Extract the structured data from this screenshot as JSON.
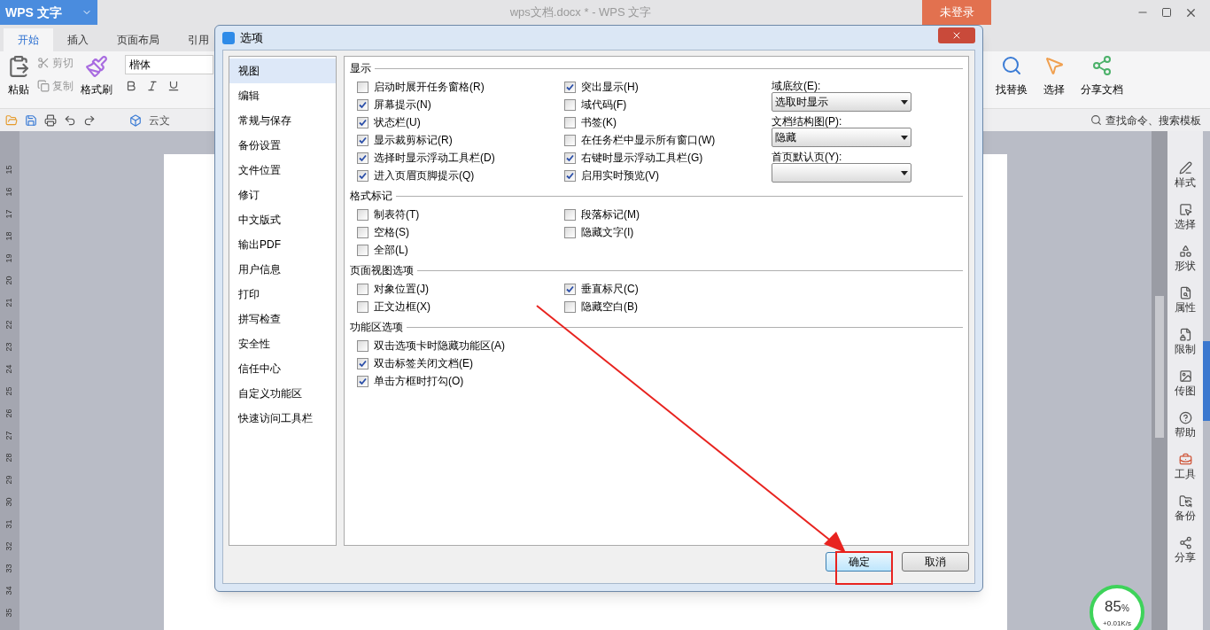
{
  "app": {
    "logo": "WPS 文字",
    "title": "wps文档.docx * - WPS 文字",
    "login": "未登录"
  },
  "tabs": [
    {
      "label": "开始",
      "selected": true
    },
    {
      "label": "插入",
      "selected": false
    },
    {
      "label": "页面布局",
      "selected": false
    },
    {
      "label": "引用",
      "selected": false
    }
  ],
  "ribbon": {
    "paste": "粘贴",
    "cut": "剪切",
    "copy": "复制",
    "format_painter": "格式刷",
    "font": "楷体",
    "find_replace": "找替换",
    "select": "选择",
    "share": "分享文档"
  },
  "quick_toolbar": {
    "cloud": "云文",
    "search": "查找命令、搜索模板"
  },
  "ruler": [
    "15",
    "16",
    "17",
    "18",
    "19",
    "20",
    "21",
    "22",
    "23",
    "24",
    "25",
    "26",
    "27",
    "28",
    "29",
    "30",
    "31",
    "32",
    "33",
    "34",
    "35"
  ],
  "dialog": {
    "title": "选项",
    "nav": [
      {
        "label": "视图",
        "selected": true
      },
      {
        "label": "编辑",
        "selected": false
      },
      {
        "label": "常规与保存",
        "selected": false
      },
      {
        "label": "备份设置",
        "selected": false
      },
      {
        "label": "文件位置",
        "selected": false
      },
      {
        "label": "修订",
        "selected": false
      },
      {
        "label": "中文版式",
        "selected": false
      },
      {
        "label": "输出PDF",
        "selected": false
      },
      {
        "label": "用户信息",
        "selected": false
      },
      {
        "label": "打印",
        "selected": false
      },
      {
        "label": "拼写检查",
        "selected": false
      },
      {
        "label": "安全性",
        "selected": false
      },
      {
        "label": "信任中心",
        "selected": false
      },
      {
        "label": "自定义功能区",
        "selected": false
      },
      {
        "label": "快速访问工具栏",
        "selected": false
      }
    ],
    "sections": [
      {
        "title": "显示",
        "columns": [
          [
            {
              "label": "启动时展开任务窗格(R)",
              "checked": false
            },
            {
              "label": "屏幕提示(N)",
              "checked": true
            },
            {
              "label": "状态栏(U)",
              "checked": true
            },
            {
              "label": "显示裁剪标记(R)",
              "checked": true
            },
            {
              "label": "选择时显示浮动工具栏(D)",
              "checked": true
            },
            {
              "label": "进入页眉页脚提示(Q)",
              "checked": true
            }
          ],
          [
            {
              "label": "突出显示(H)",
              "checked": true
            },
            {
              "label": "域代码(F)",
              "checked": false
            },
            {
              "label": "书签(K)",
              "checked": false
            },
            {
              "label": "在任务栏中显示所有窗口(W)",
              "checked": false
            },
            {
              "label": "右键时显示浮动工具栏(G)",
              "checked": true
            },
            {
              "label": "启用实时预览(V)",
              "checked": true
            }
          ]
        ],
        "dropdowns": [
          {
            "label": "域底纹(E):",
            "value": "选取时显示"
          },
          {
            "label": "文档结构图(P):",
            "value": "隐藏"
          },
          {
            "label": "首页默认页(Y):"
          }
        ]
      },
      {
        "title": "格式标记",
        "columns": [
          [
            {
              "label": "制表符(T)",
              "checked": false
            },
            {
              "label": "空格(S)",
              "checked": false
            },
            {
              "label": "全部(L)",
              "checked": false
            }
          ],
          [
            {
              "label": "段落标记(M)",
              "checked": false
            },
            {
              "label": "隐藏文字(I)",
              "checked": false
            }
          ]
        ]
      },
      {
        "title": "页面视图选项",
        "columns": [
          [
            {
              "label": "对象位置(J)",
              "checked": false
            },
            {
              "label": "正文边框(X)",
              "checked": false
            }
          ],
          [
            {
              "label": "垂直标尺(C)",
              "checked": true
            },
            {
              "label": "隐藏空白(B)",
              "checked": false
            }
          ]
        ]
      },
      {
        "title": "功能区选项",
        "columns": [
          [
            {
              "label": "双击选项卡时隐藏功能区(A)",
              "checked": false
            },
            {
              "label": "双击标签关闭文档(E)",
              "checked": true
            },
            {
              "label": "单击方框时打勾(O)",
              "checked": true
            }
          ]
        ]
      }
    ],
    "buttons": [
      {
        "label": "确定",
        "kind": "primary"
      },
      {
        "label": "取消",
        "kind": "secondary"
      }
    ]
  },
  "side_panel": [
    {
      "label": "样式"
    },
    {
      "label": "选择"
    },
    {
      "label": "形状"
    },
    {
      "label": "属性"
    },
    {
      "label": "限制"
    },
    {
      "label": "传图"
    },
    {
      "label": "帮助"
    },
    {
      "label": "工具"
    },
    {
      "label": "备份"
    },
    {
      "label": "分享"
    }
  ],
  "network": {
    "percent": "85",
    "unit": "%",
    "speed": "+0.01K/s"
  }
}
